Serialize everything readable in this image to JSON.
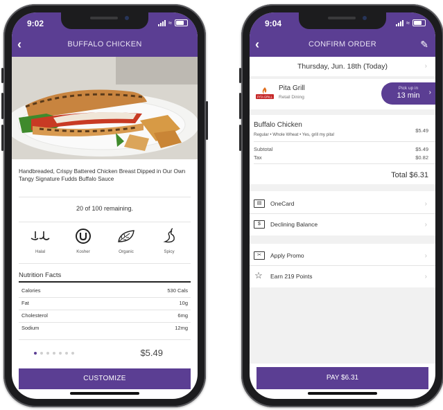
{
  "left_phone": {
    "status_time": "9:02",
    "nav_title": "BUFFALO CHICKEN",
    "description": "Handbreaded, Crispy Battered Chicken Breast Dipped in Our Own Tangy Signature Fudds Buffalo Sauce",
    "remaining": "20 of 100 remaining.",
    "tags": [
      {
        "label": "Halal",
        "icon": "halal-icon"
      },
      {
        "label": "Kosher",
        "icon": "kosher-icon"
      },
      {
        "label": "Organic",
        "icon": "leaf-icon"
      },
      {
        "label": "Spicy",
        "icon": "pepper-icon"
      }
    ],
    "nutrition_title": "Nutrition Facts",
    "nutrition": [
      {
        "name": "Calories",
        "value": "530 Cals"
      },
      {
        "name": "Fat",
        "value": "10g"
      },
      {
        "name": "Cholesterol",
        "value": "6mg"
      },
      {
        "name": "Sodium",
        "value": "12mg"
      }
    ],
    "carousel": {
      "total": 7,
      "active": 1
    },
    "price": "$5.49",
    "customize_label": "CUSTOMIZE"
  },
  "right_phone": {
    "status_time": "9:04",
    "nav_title": "CONFIRM ORDER",
    "date": "Thursday, Jun. 18th (Today)",
    "vendor": {
      "name": "Pita Grill",
      "sub": "Retail Dining",
      "logo_text": "PITA GRILL"
    },
    "pickup": {
      "label": "Pick up in",
      "time": "13 min"
    },
    "item": {
      "name": "Buffalo Chicken",
      "options": "Regular • Whole Wheat • Yes, grill my pita!",
      "price": "$5.49"
    },
    "subtotal": {
      "label": "Subtotal",
      "value": "$5.49"
    },
    "tax": {
      "label": "Tax",
      "value": "$0.82"
    },
    "total": "Total $6.31",
    "payment_methods": [
      {
        "label": "OneCard",
        "icon": "card-icon"
      },
      {
        "label": "Declining Balance",
        "icon": "cash-icon"
      }
    ],
    "promos": [
      {
        "label": "Apply Promo",
        "icon": "coupon-icon"
      },
      {
        "label": "Earn 219 Points",
        "icon": "star-icon"
      }
    ],
    "pay_label": "PAY $6.31"
  },
  "colors": {
    "brand_purple": "#5b3e93",
    "logo_red": "#c62828"
  }
}
